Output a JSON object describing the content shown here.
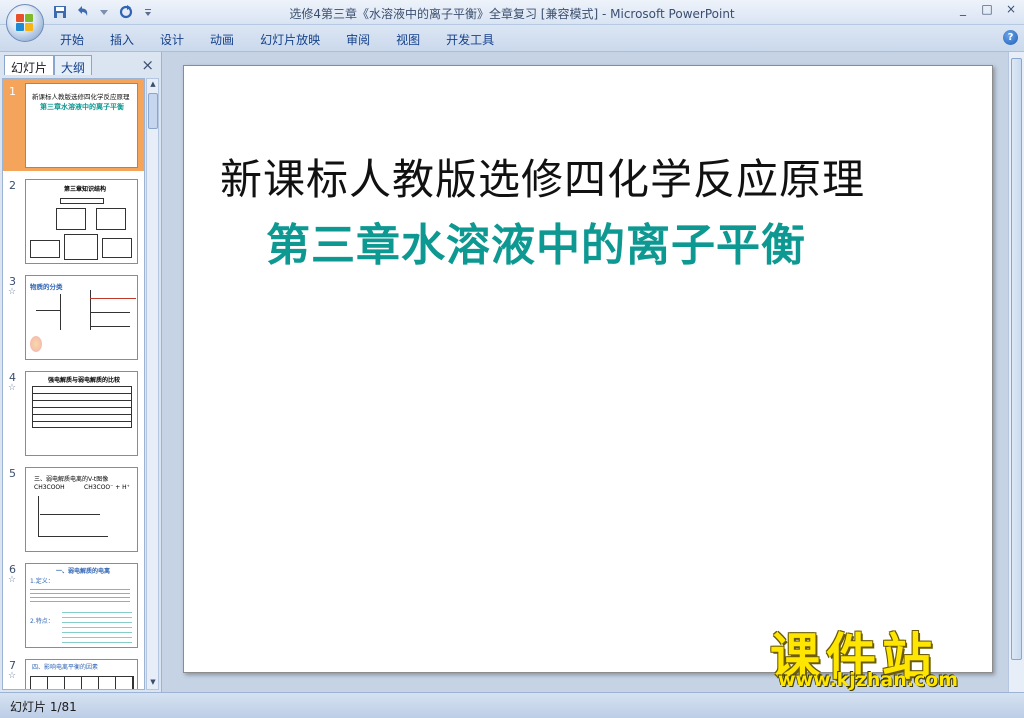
{
  "window": {
    "title": "选修4第三章《水溶液中的离子平衡》全章复习 [兼容模式] - Microsoft PowerPoint",
    "controls": [
      "_",
      "□",
      "×"
    ]
  },
  "ribbon": {
    "tabs": [
      "开始",
      "插入",
      "设计",
      "动画",
      "幻灯片放映",
      "审阅",
      "视图",
      "开发工具"
    ],
    "help": "?"
  },
  "panel": {
    "tab_slides": "幻灯片",
    "tab_outline": "大纲",
    "close": "×"
  },
  "thumbnails": [
    {
      "num": "1",
      "line1": "新课标人教版选修四化学反应原理",
      "line2": "第三章水溶液中的离子平衡"
    },
    {
      "num": "2",
      "line1": "第三章知识结构"
    },
    {
      "num": "3",
      "line1": "物质的分类"
    },
    {
      "num": "4",
      "line1": "强电解质与弱电解质的比较"
    },
    {
      "num": "5",
      "line1": "三、弱电解质电离的V-t图像",
      "line2": "CH3COOH",
      "line3": "CH3COO⁻ + H⁺"
    },
    {
      "num": "6",
      "line1": "一、弱电解质的电离",
      "line2": "1.定义：",
      "line3": "2.特点："
    },
    {
      "num": "7",
      "line1": "四、影响电离平衡的因素"
    }
  ],
  "slide": {
    "title": "新课标人教版选修四化学反应原理",
    "subtitle": "第三章水溶液中的离子平衡"
  },
  "watermark": {
    "main": "课件站",
    "url": "www.kjzhan.com"
  },
  "status": {
    "text": "幻灯片 1/81"
  },
  "colors": {
    "subtitle": "#0d9892",
    "selected_thumb": "#f4a45b",
    "watermark": "#ffe600"
  }
}
